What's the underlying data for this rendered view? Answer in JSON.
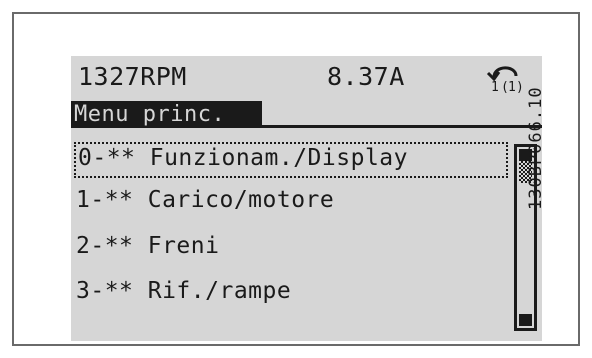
{
  "display": {
    "speed": "1327RPM",
    "current": "8.37A",
    "active_setup": "1",
    "edit_setup": "1",
    "menu_title": "Menu princ.",
    "items": [
      {
        "label": "0-** Funzionam./Display",
        "selected": true
      },
      {
        "label": "1-** Carico/motore",
        "selected": false
      },
      {
        "label": "2-** Freni",
        "selected": false
      },
      {
        "label": "3-** Rif./rampe",
        "selected": false
      }
    ]
  },
  "figure_code": "130BP066.10",
  "colors": {
    "lcd_background": "#d6d6d6",
    "lcd_foreground": "#1a1a1a",
    "frame_border": "#6a6a6a"
  },
  "icons": {
    "setup": "setup-indicator-icon",
    "scroll_up": "scroll-up-arrow-icon",
    "scroll_down": "scroll-down-arrow-icon"
  }
}
